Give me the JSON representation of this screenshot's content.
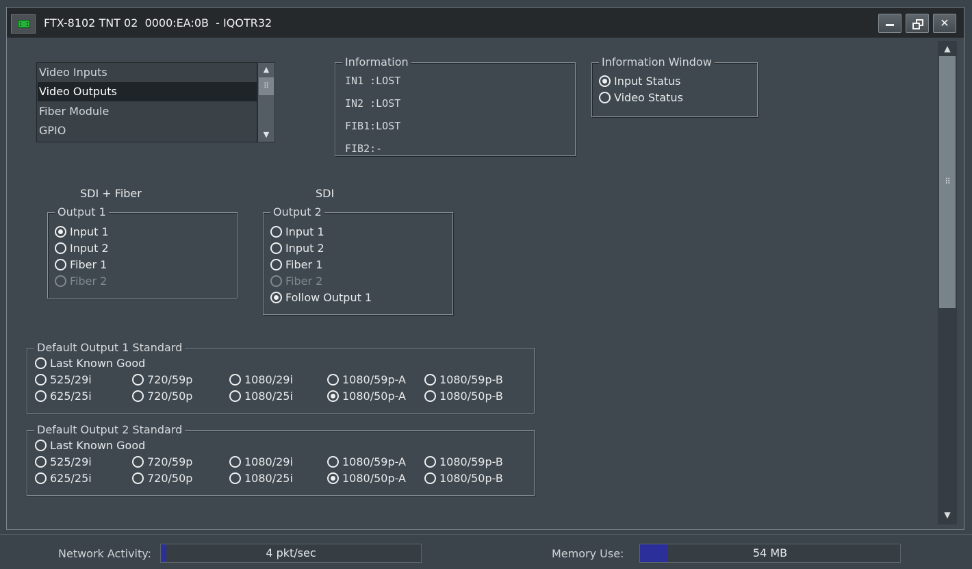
{
  "window": {
    "title": "FTX-8102 TNT 02  0000:EA:0B  - IQOTR32",
    "icon": "card-chip-icon",
    "buttons": {
      "minimize": "minimize-icon",
      "restore": "restore-icon",
      "close": "✕"
    }
  },
  "nav_list": {
    "items": [
      "Video Inputs",
      "Video Outputs",
      "Fiber Module",
      "GPIO"
    ],
    "selected": "Video Outputs"
  },
  "information": {
    "legend": "Information",
    "lines": [
      "IN1 :LOST",
      "IN2 :LOST",
      "FIB1:LOST",
      "FIB2:-"
    ]
  },
  "information_window": {
    "legend": "Information Window",
    "options": [
      "Input Status",
      "Video Status"
    ],
    "selected": "Input Status"
  },
  "output1": {
    "header": "SDI + Fiber",
    "legend": "Output 1",
    "options": [
      "Input 1",
      "Input 2",
      "Fiber 1",
      "Fiber 2"
    ],
    "selected": "Input 1",
    "disabled": [
      "Fiber 2"
    ]
  },
  "output2": {
    "header": "SDI",
    "legend": "Output 2",
    "options": [
      "Input 1",
      "Input 2",
      "Fiber 1",
      "Fiber 2",
      "Follow Output 1"
    ],
    "selected": "Follow Output 1",
    "disabled": [
      "Fiber 2"
    ]
  },
  "default_output1": {
    "legend": "Default Output 1 Standard",
    "last_known_good": "Last Known Good",
    "row1": [
      "525/29i",
      "720/59p",
      "1080/29i",
      "1080/59p-A",
      "1080/59p-B"
    ],
    "row2": [
      "625/25i",
      "720/50p",
      "1080/25i",
      "1080/50p-A",
      "1080/50p-B"
    ],
    "selected": "1080/50p-A"
  },
  "default_output2": {
    "legend": "Default Output 2 Standard",
    "last_known_good": "Last Known Good",
    "row1": [
      "525/29i",
      "720/59p",
      "1080/29i",
      "1080/59p-A",
      "1080/59p-B"
    ],
    "row2": [
      "625/25i",
      "720/50p",
      "1080/25i",
      "1080/50p-A",
      "1080/50p-B"
    ],
    "selected": "1080/50p-A"
  },
  "status_bar": {
    "network_label": "Network Activity:",
    "network_value": "4 pkt/sec",
    "network_level": 0.005,
    "memory_label": "Memory Use:",
    "memory_value": "54 MB",
    "memory_level": 0.105
  },
  "colors": {
    "meter_fill": "#2b2f99",
    "selection_bg": "#1f2428"
  }
}
